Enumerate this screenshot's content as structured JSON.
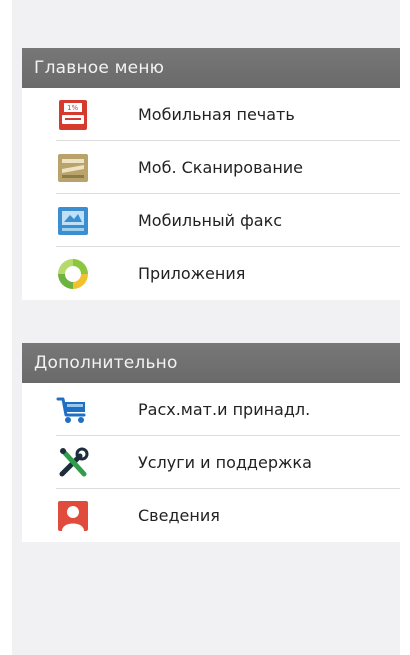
{
  "main_menu": {
    "header": "Главное меню",
    "items": [
      {
        "label": "Мобильная печать",
        "icon": "mobile-print-icon"
      },
      {
        "label": "Моб. Сканирование",
        "icon": "mobile-scan-icon"
      },
      {
        "label": "Мобильный факс",
        "icon": "mobile-fax-icon"
      },
      {
        "label": "Приложения",
        "icon": "apps-icon"
      }
    ]
  },
  "additional": {
    "header": "Дополнительно",
    "items": [
      {
        "label": "Расх.мат.и принадл.",
        "icon": "cart-icon"
      },
      {
        "label": "Услуги и поддержка",
        "icon": "tools-icon"
      },
      {
        "label": "Сведения",
        "icon": "info-person-icon"
      }
    ]
  },
  "colors": {
    "header_bg": "#707070",
    "screen_bg": "#f1f1f4",
    "print_icon": "#d63a2c",
    "scan_icon": "#b9a36a",
    "fax_icon": "#3b8fd0",
    "apps_icon": "#8cc63f",
    "cart_icon": "#1f6fc5",
    "info_icon": "#e14b3b"
  }
}
